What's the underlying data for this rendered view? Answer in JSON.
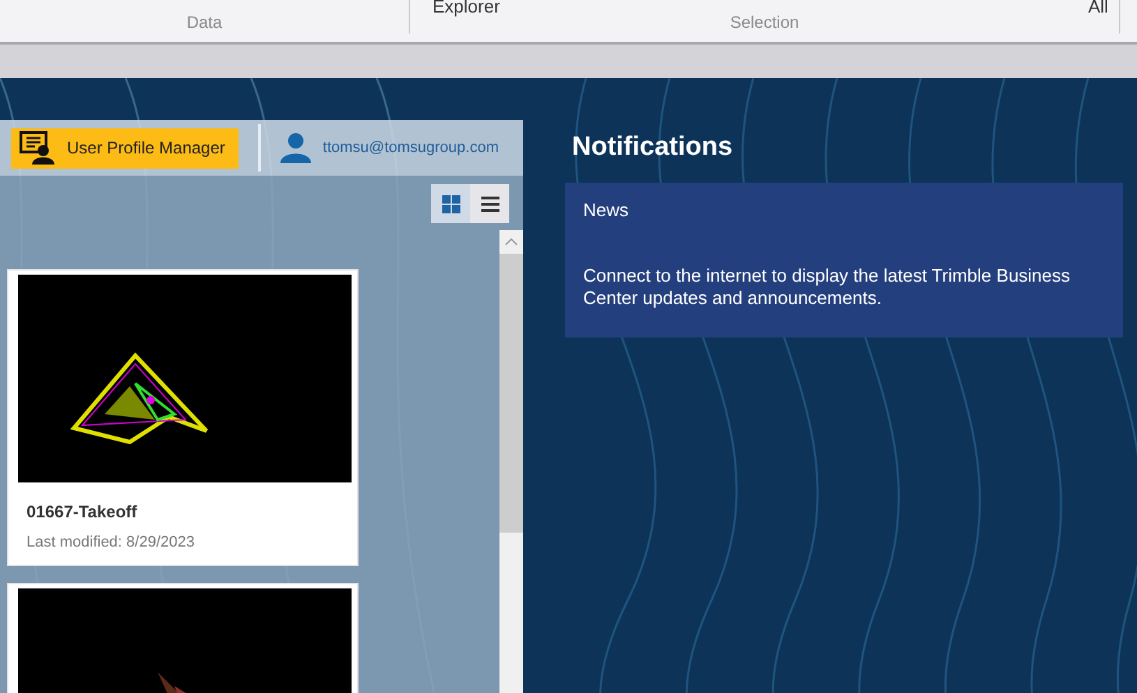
{
  "ribbon": {
    "items": [
      {
        "label": "Explorer"
      },
      {
        "label": "All"
      }
    ],
    "groups": [
      {
        "label": "Data"
      },
      {
        "label": "Selection"
      }
    ]
  },
  "profile_bar": {
    "manager_button": "User Profile Manager",
    "user_email": "ttomsu@tomsugroup.com"
  },
  "view_toggle": [
    {
      "kind": "grid",
      "selected": true
    },
    {
      "kind": "list",
      "selected": false
    }
  ],
  "projects": [
    {
      "name": "01667-Takeoff",
      "modified": "Last modified: 8/29/2023",
      "kind": "picture"
    },
    {
      "kind": "picture"
    }
  ],
  "notifications": {
    "title": "Notifications",
    "news": {
      "heading": "News",
      "message": "Connect to the internet to display the latest Trimble Business Center updates and announcements."
    }
  }
}
